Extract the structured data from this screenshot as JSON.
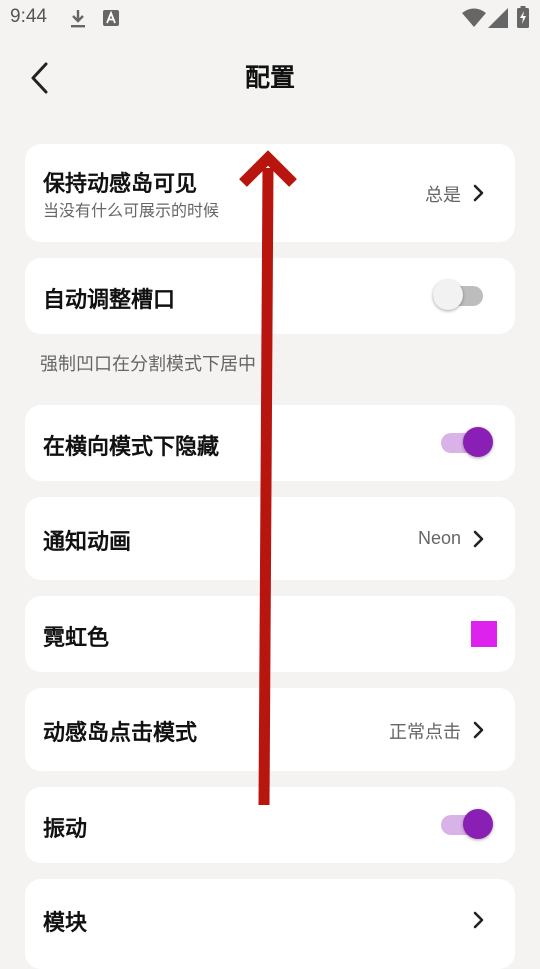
{
  "status_bar": {
    "time": "9:44",
    "icons": [
      "download-icon",
      "a-letter-icon",
      "wifi-icon",
      "signal-icon",
      "battery-charging-icon"
    ]
  },
  "app_bar": {
    "title": "配置",
    "back_icon": "chevron-left-icon"
  },
  "settings": {
    "keep_island_visible": {
      "label": "保持动感岛可见",
      "subtitle": "当没有什么可展示的时候",
      "value": "总是"
    },
    "auto_adjust_notch": {
      "label": "自动调整槽口",
      "enabled": false
    },
    "notch_hint": "强制凹口在分割模式下居中",
    "hide_landscape": {
      "label": "在横向模式下隐藏",
      "enabled": true
    },
    "notification_animation": {
      "label": "通知动画",
      "value": "Neon"
    },
    "neon_color": {
      "label": "霓虹色",
      "color": "#dd22ee"
    },
    "click_mode": {
      "label": "动感岛点击模式",
      "value": "正常点击"
    },
    "vibration": {
      "label": "振动",
      "enabled": true
    },
    "modules": {
      "label": "模块"
    }
  },
  "colors": {
    "accent": "#8a1fb5",
    "accent_track": "#d9b3e8",
    "off_track": "#bdbdbd",
    "off_thumb": "#f2f2f2",
    "gesture_arrow": "#b8150f"
  },
  "overlay": {
    "gesture": "swipe-up-arrow"
  }
}
